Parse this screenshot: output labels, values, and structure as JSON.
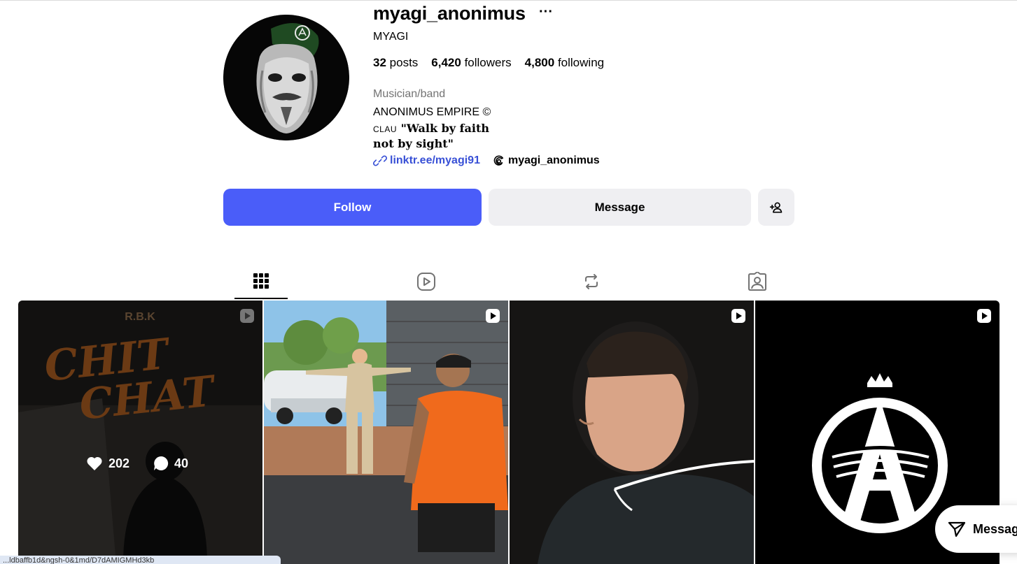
{
  "profile": {
    "username": "myagi_anonimus",
    "more_label": "···",
    "full_name": "MYAGI",
    "stats": {
      "posts_num": "32",
      "posts_label": "posts",
      "followers_num": "6,420",
      "followers_label": "followers",
      "following_num": "4,800",
      "following_label": "following"
    },
    "category": "Musician/band",
    "bio_line1": "ANONIMUS EMPIRE ©",
    "bio_line2_small": "CLAU",
    "bio_line2": "\"Walk by faith",
    "bio_line3": "not by sight\"",
    "link_text": "linktr.ee/myagi91",
    "threads_handle": "myagi_anonimus"
  },
  "actions": {
    "follow_label": "Follow",
    "message_label": "Message"
  },
  "tabs": [
    "posts",
    "reels",
    "reposts",
    "tagged"
  ],
  "posts": [
    {
      "title_top": "R.B.K",
      "title_main_1": "CHIT",
      "title_main_2": "CHAT",
      "likes": "202",
      "comments": "40",
      "hovered": true
    },
    {
      "type": "reel"
    },
    {
      "type": "reel"
    },
    {
      "type": "reel"
    }
  ],
  "floating_message": {
    "label": "Messag"
  },
  "status_url": "...ldbaffb1d&ngsh-0&1md/D7dAMIGMHd3kb"
}
